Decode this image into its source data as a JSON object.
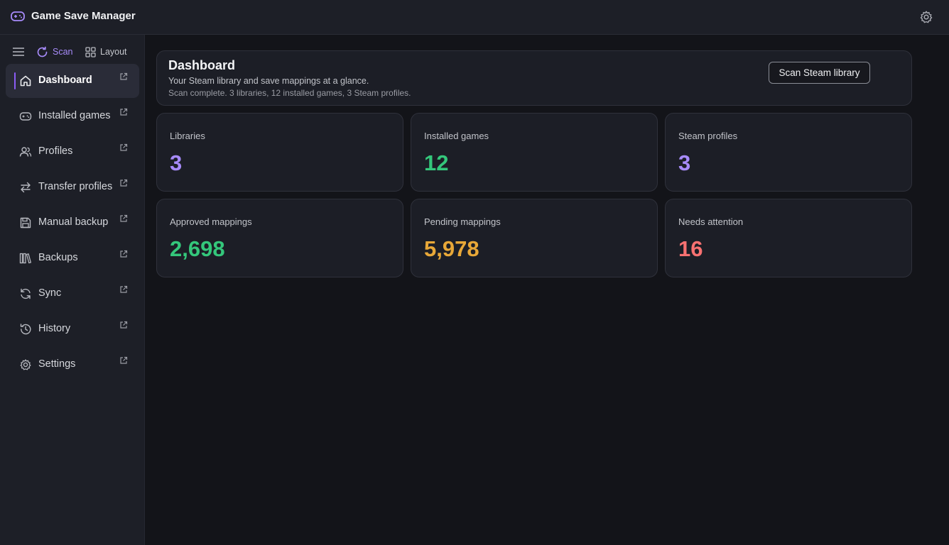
{
  "app": {
    "title": "Game Save Manager"
  },
  "toolbar": {
    "scan_label": "Scan",
    "layout_label": "Layout"
  },
  "sidebar": {
    "items": [
      {
        "label": "Dashboard",
        "icon": "home-icon",
        "active": true
      },
      {
        "label": "Installed games",
        "icon": "gamepad-icon"
      },
      {
        "label": "Profiles",
        "icon": "users-icon"
      },
      {
        "label": "Transfer profiles",
        "icon": "transfer-icon"
      },
      {
        "label": "Manual backup",
        "icon": "save-icon"
      },
      {
        "label": "Backups",
        "icon": "library-icon"
      },
      {
        "label": "Sync",
        "icon": "sync-icon"
      },
      {
        "label": "History",
        "icon": "history-icon"
      },
      {
        "label": "Settings",
        "icon": "gear-icon"
      }
    ]
  },
  "header": {
    "title": "Dashboard",
    "subtitle": "Your Steam library and save mappings at a glance.",
    "status": "Scan complete. 3 libraries, 12 installed games, 3 Steam profiles.",
    "scan_button": "Scan Steam library"
  },
  "stats": [
    {
      "label": "Libraries",
      "value": "3",
      "color": "#a78bfa"
    },
    {
      "label": "Installed games",
      "value": "12",
      "color": "#34c77b"
    },
    {
      "label": "Steam profiles",
      "value": "3",
      "color": "#a78bfa"
    },
    {
      "label": "Approved mappings",
      "value": "2,698",
      "color": "#34c77b"
    },
    {
      "label": "Pending mappings",
      "value": "5,978",
      "color": "#e8a838"
    },
    {
      "label": "Needs attention",
      "value": "16",
      "color": "#f87171"
    }
  ],
  "colors": {
    "accent": "#8b5cf6",
    "scan_accent": "#a78bfa"
  }
}
